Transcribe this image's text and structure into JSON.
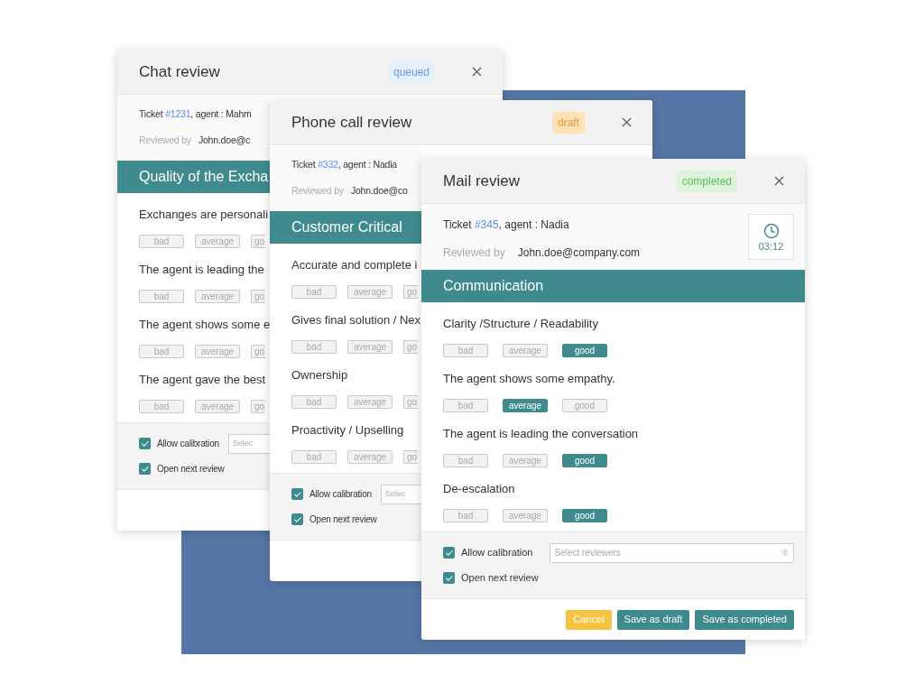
{
  "windows": [
    {
      "title": "Chat review",
      "status": {
        "label": "queued",
        "kind": "queued"
      },
      "ticket": {
        "prefix": "Ticket ",
        "number": "#1231",
        "suffix": ", agent : Mahm"
      },
      "reviewed_by": "Reviewed by",
      "reviewer": "John.doe@c",
      "section": "Quality of the Excha",
      "questions": [
        {
          "label": "Exchanges are personali",
          "ratings": [
            {
              "label": "bad",
              "selected": false
            },
            {
              "label": "average",
              "selected": false
            },
            {
              "label": "go",
              "selected": false
            }
          ]
        },
        {
          "label": "The agent is leading the",
          "ratings": [
            {
              "label": "bad",
              "selected": false
            },
            {
              "label": "average",
              "selected": false
            },
            {
              "label": "go",
              "selected": false
            }
          ]
        },
        {
          "label": "The agent shows some e",
          "ratings": [
            {
              "label": "bad",
              "selected": false
            },
            {
              "label": "average",
              "selected": false
            },
            {
              "label": "go",
              "selected": false
            }
          ]
        },
        {
          "label": "The agent gave the best",
          "ratings": [
            {
              "label": "bad",
              "selected": false
            },
            {
              "label": "average",
              "selected": false
            },
            {
              "label": "go",
              "selected": false
            }
          ]
        }
      ],
      "options": [
        {
          "label": "Allow calibration",
          "checked": true
        },
        {
          "label": "Open next review",
          "checked": true
        }
      ],
      "reviewers_field": {
        "placeholder": "Selec"
      }
    },
    {
      "title": "Phone call review",
      "status": {
        "label": "draft",
        "kind": "draft"
      },
      "ticket": {
        "prefix": "Ticket ",
        "number": "#332",
        "suffix": ", agent : Nadia"
      },
      "reviewed_by": "Reviewed by",
      "reviewer": "John.doe@co",
      "section": "Customer Critical",
      "questions": [
        {
          "label": "Accurate and complete i",
          "ratings": [
            {
              "label": "bad",
              "selected": false
            },
            {
              "label": "average",
              "selected": false
            },
            {
              "label": "go",
              "selected": false
            }
          ]
        },
        {
          "label": "Gives final solution / Nex",
          "ratings": [
            {
              "label": "bad",
              "selected": false
            },
            {
              "label": "average",
              "selected": false
            },
            {
              "label": "go",
              "selected": false
            }
          ]
        },
        {
          "label": "Ownership",
          "ratings": [
            {
              "label": "bad",
              "selected": false
            },
            {
              "label": "average",
              "selected": false
            },
            {
              "label": "go",
              "selected": false
            }
          ]
        },
        {
          "label": "Proactivity / Upselling",
          "ratings": [
            {
              "label": "bad",
              "selected": false
            },
            {
              "label": "average",
              "selected": false
            },
            {
              "label": "go",
              "selected": false
            }
          ]
        }
      ],
      "options": [
        {
          "label": "Allow calibration",
          "checked": true
        },
        {
          "label": "Open next review",
          "checked": true
        }
      ],
      "reviewers_field": {
        "placeholder": "Selec"
      }
    },
    {
      "title": "Mail review",
      "status": {
        "label": "completed",
        "kind": "completed"
      },
      "ticket": {
        "prefix": "Ticket ",
        "number": "#345",
        "suffix": ", agent : Nadia"
      },
      "reviewed_by": "Reviewed by",
      "reviewer": "John.doe@company.com",
      "timer": "03:12",
      "section": "Communication",
      "questions": [
        {
          "label": "Clarity /Structure / Readability",
          "ratings": [
            {
              "label": "bad",
              "selected": false
            },
            {
              "label": "average",
              "selected": false
            },
            {
              "label": "good",
              "selected": true
            }
          ]
        },
        {
          "label": "The agent shows some empathy.",
          "ratings": [
            {
              "label": "bad",
              "selected": false
            },
            {
              "label": "average",
              "selected": true
            },
            {
              "label": "good",
              "selected": false
            }
          ]
        },
        {
          "label": "The agent is leading the conversation",
          "ratings": [
            {
              "label": "bad",
              "selected": false
            },
            {
              "label": "average",
              "selected": false
            },
            {
              "label": "good",
              "selected": true
            }
          ]
        },
        {
          "label": "De-escalation",
          "ratings": [
            {
              "label": "bad",
              "selected": false
            },
            {
              "label": "average",
              "selected": false
            },
            {
              "label": "good",
              "selected": true
            }
          ]
        }
      ],
      "options": [
        {
          "label": "Allow calibration",
          "checked": true
        },
        {
          "label": "Open next review",
          "checked": true
        }
      ],
      "reviewers_field": {
        "placeholder": "Select reviewers"
      },
      "buttons": [
        {
          "label": "Cancel",
          "kind": "cancel"
        },
        {
          "label": "Save as draft",
          "kind": "primary"
        },
        {
          "label": "Save as completed",
          "kind": "primary"
        }
      ]
    }
  ]
}
